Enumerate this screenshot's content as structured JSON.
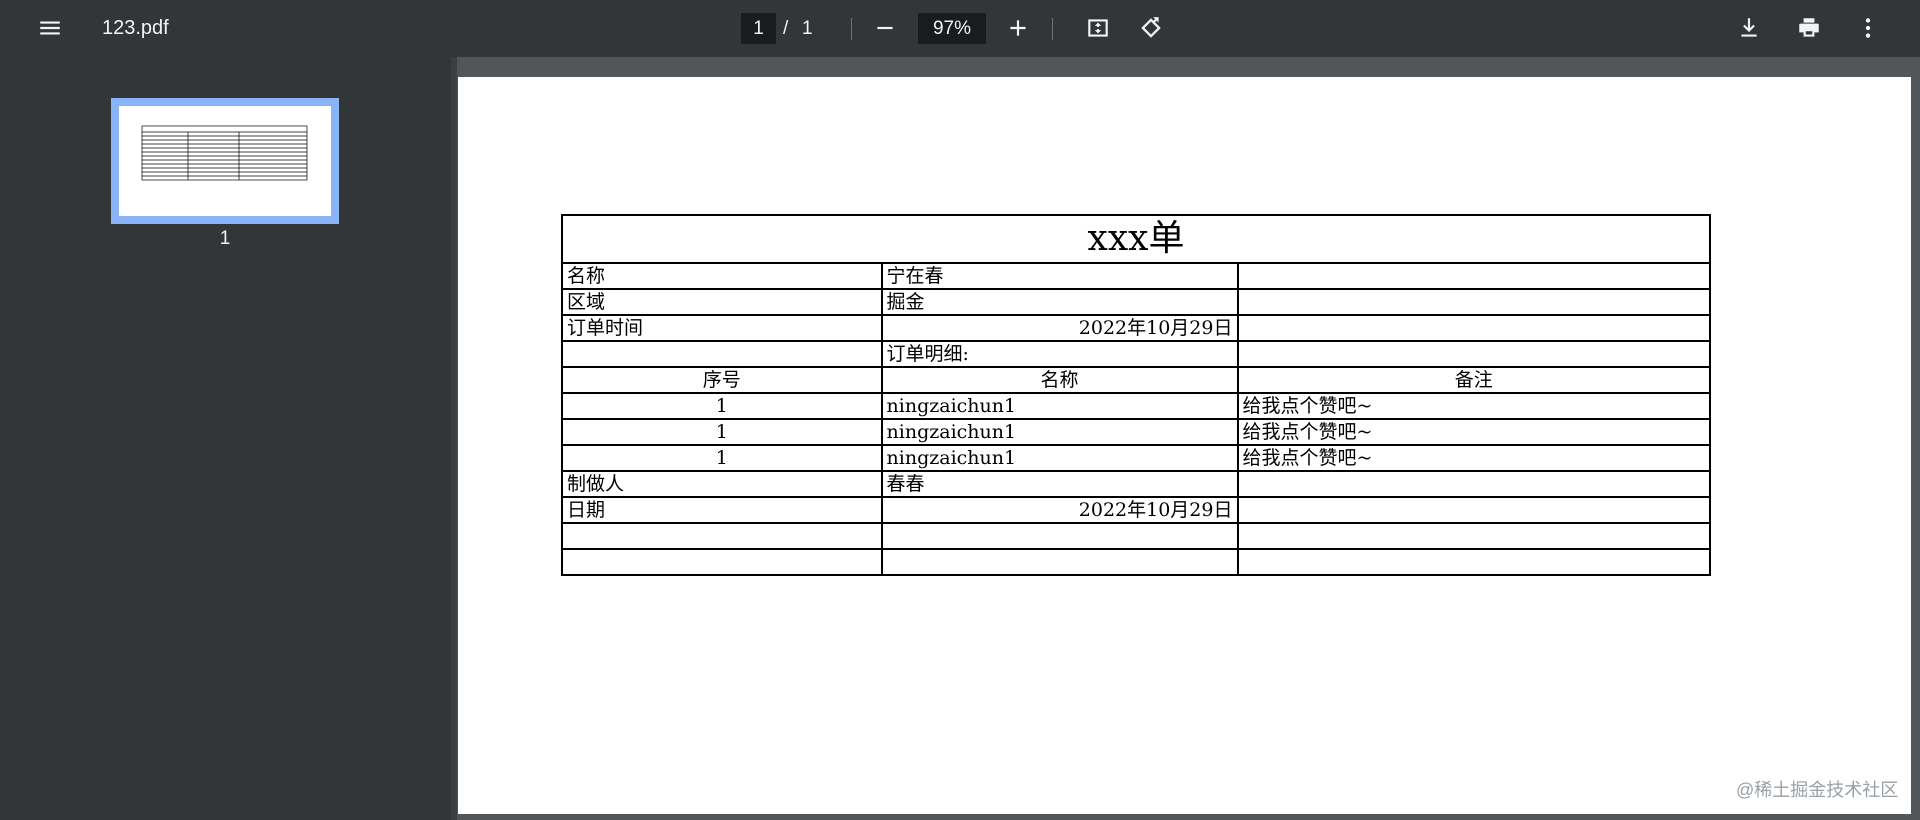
{
  "toolbar": {
    "title": "123.pdf",
    "page_current": "1",
    "page_separator": "/",
    "page_total": "1",
    "zoom": "97%"
  },
  "sidebar": {
    "thumbnails": [
      {
        "label": "1"
      }
    ]
  },
  "document": {
    "title": "xxx单",
    "rows": [
      {
        "c1": "名称",
        "c2": "宁在春",
        "c3": ""
      },
      {
        "c1": "区域",
        "c2": "掘金",
        "c3": ""
      },
      {
        "c1": "订单时间",
        "c2": "2022年10月29日",
        "c3": ""
      },
      {
        "c1": "",
        "c2": "订单明细:",
        "c3": ""
      },
      {
        "c1": "序号",
        "c2": "名称",
        "c3": "备注"
      },
      {
        "c1": "1",
        "c2": "ningzaichun1",
        "c3": "给我点个赞吧~"
      },
      {
        "c1": "1",
        "c2": "ningzaichun1",
        "c3": "给我点个赞吧~"
      },
      {
        "c1": "1",
        "c2": "ningzaichun1",
        "c3": "给我点个赞吧~"
      },
      {
        "c1": "制做人",
        "c2": "春春",
        "c3": ""
      },
      {
        "c1": "日期",
        "c2": "2022年10月29日",
        "c3": ""
      },
      {
        "c1": "",
        "c2": "",
        "c3": ""
      },
      {
        "c1": "",
        "c2": "",
        "c3": ""
      }
    ]
  },
  "watermark": "@稀土掘金技术社区",
  "icons": {
    "menu": "menu-icon",
    "zoom_out": "minus-icon",
    "zoom_in": "plus-icon",
    "fit": "fit-to-page-icon",
    "rotate": "rotate-icon",
    "download": "download-icon",
    "print": "print-icon",
    "more": "more-vert-icon"
  },
  "colors": {
    "toolbar_bg": "#323639",
    "viewer_bg": "#525659",
    "thumb_highlight": "#8ab4f8"
  }
}
